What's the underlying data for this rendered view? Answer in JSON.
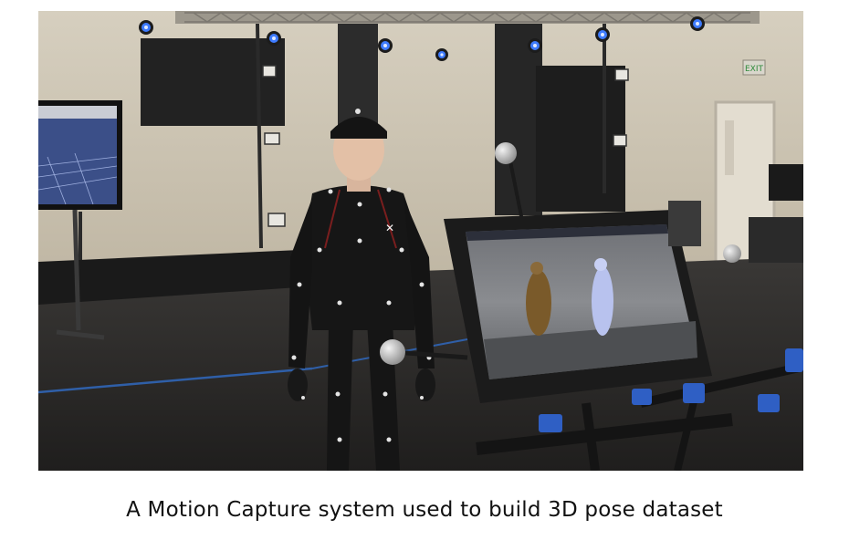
{
  "caption": "A Motion Capture system used to build 3D pose dataset"
}
